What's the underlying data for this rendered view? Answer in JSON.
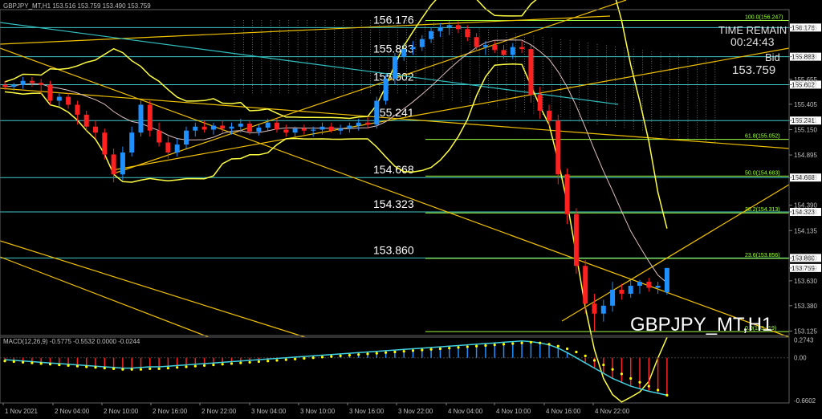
{
  "header": {
    "symbol_info": "GBPJPY_MT,H1  153.516 153.759 153.490 153.759"
  },
  "timer": {
    "label": "TIME REMAIN",
    "value": "00:24:43"
  },
  "bid": {
    "label": "Bid",
    "value": "153.759"
  },
  "watermark": "GBPJPY_MT,H1",
  "macd_header": "MACD(12,26,9) -0.5775 -0.5532 0.0000 -0.0244",
  "colors": {
    "bull": "#1e90ff",
    "bear": "#ff2020",
    "level": "#40c8c8",
    "trend": "#f0c000",
    "bands": "#ffff40",
    "fib": "#a0ff40"
  },
  "chart_data": [
    {
      "type": "candlestick",
      "title": "GBPJPY_MT,H1",
      "ylim": [
        153.08,
        156.34
      ],
      "y_ticks": [
        "156.176",
        "155.883",
        "155.655",
        "155.602",
        "155.405",
        "155.241",
        "155.150",
        "154.895",
        "154.668",
        "154.390",
        "154.323",
        "154.135",
        "153.860",
        "153.759",
        "153.630",
        "153.380",
        "153.125"
      ],
      "x_ticks": [
        "1 Nov 2021",
        "2 Nov 04:00",
        "2 Nov 10:00",
        "2 Nov 16:00",
        "2 Nov 22:00",
        "3 Nov 04:00",
        "3 Nov 10:00",
        "3 Nov 16:00",
        "3 Nov 22:00",
        "4 Nov 04:00",
        "4 Nov 10:00",
        "4 Nov 16:00",
        "4 Nov 22:00"
      ],
      "horizontal_levels": [
        "156.176",
        "155.883",
        "155.602",
        "155.241",
        "154.668",
        "154.323",
        "153.860"
      ],
      "fib_levels": [
        {
          "label": "100.0(156.247)",
          "value": 156.247
        },
        {
          "label": "61.8(155.052)",
          "value": 155.052
        },
        {
          "label": "50.0(154.683)",
          "value": 154.683
        },
        {
          "label": "38.2(154.313)",
          "value": 154.313
        },
        {
          "label": "23.6(153.856)",
          "value": 153.856
        },
        {
          "label": "0.0(153.119)",
          "value": 153.119
        }
      ],
      "current_price": "153.759",
      "candles": [
        [
          155.6,
          155.64,
          155.55,
          155.58
        ],
        [
          155.58,
          155.62,
          155.54,
          155.6
        ],
        [
          155.6,
          155.68,
          155.56,
          155.64
        ],
        [
          155.64,
          155.68,
          155.58,
          155.62
        ],
        [
          155.62,
          155.66,
          155.5,
          155.6
        ],
        [
          155.6,
          155.64,
          155.4,
          155.44
        ],
        [
          155.44,
          155.52,
          155.38,
          155.48
        ],
        [
          155.48,
          155.52,
          155.36,
          155.4
        ],
        [
          155.4,
          155.44,
          155.2,
          155.3
        ],
        [
          155.3,
          155.34,
          155.14,
          155.18
        ],
        [
          155.18,
          155.24,
          155.06,
          155.12
        ],
        [
          155.12,
          155.16,
          154.85,
          154.9
        ],
        [
          154.9,
          154.96,
          154.62,
          154.7
        ],
        [
          154.7,
          154.98,
          154.64,
          154.92
        ],
        [
          154.92,
          155.18,
          154.88,
          155.12
        ],
        [
          155.12,
          155.44,
          155.08,
          155.4
        ],
        [
          155.4,
          155.44,
          155.08,
          155.14
        ],
        [
          155.14,
          155.22,
          154.98,
          155.02
        ],
        [
          155.02,
          155.08,
          154.86,
          154.92
        ],
        [
          154.92,
          155.06,
          154.88,
          155.0
        ],
        [
          155.0,
          155.18,
          154.96,
          155.14
        ],
        [
          155.14,
          155.22,
          155.08,
          155.18
        ],
        [
          155.18,
          155.24,
          155.12,
          155.15
        ],
        [
          155.15,
          155.22,
          155.1,
          155.19
        ],
        [
          155.19,
          155.24,
          155.12,
          155.16
        ],
        [
          155.16,
          155.22,
          155.1,
          155.18
        ],
        [
          155.18,
          155.26,
          155.12,
          155.21
        ],
        [
          155.21,
          155.24,
          155.1,
          155.13
        ],
        [
          155.13,
          155.2,
          155.09,
          155.17
        ],
        [
          155.17,
          155.26,
          155.14,
          155.22
        ],
        [
          155.22,
          155.26,
          155.12,
          155.15
        ],
        [
          155.15,
          155.2,
          155.08,
          155.12
        ],
        [
          155.12,
          155.18,
          155.08,
          155.16
        ],
        [
          155.16,
          155.2,
          155.1,
          155.14
        ],
        [
          155.14,
          155.18,
          155.08,
          155.15
        ],
        [
          155.15,
          155.22,
          155.1,
          155.18
        ],
        [
          155.18,
          155.22,
          155.12,
          155.14
        ],
        [
          155.14,
          155.2,
          155.1,
          155.16
        ],
        [
          155.16,
          155.22,
          155.12,
          155.19
        ],
        [
          155.19,
          155.26,
          155.14,
          155.22
        ],
        [
          155.22,
          155.28,
          155.16,
          155.2
        ],
        [
          155.2,
          155.48,
          155.16,
          155.44
        ],
        [
          155.44,
          155.7,
          155.4,
          155.66
        ],
        [
          155.66,
          155.92,
          155.6,
          155.88
        ],
        [
          155.88,
          156.02,
          155.84,
          155.96
        ],
        [
          155.96,
          156.04,
          155.9,
          155.98
        ],
        [
          155.98,
          156.1,
          155.94,
          156.06
        ],
        [
          156.06,
          156.18,
          156.02,
          156.14
        ],
        [
          156.14,
          156.22,
          156.08,
          156.18
        ],
        [
          156.18,
          156.24,
          156.1,
          156.2
        ],
        [
          156.2,
          156.24,
          156.12,
          156.16
        ],
        [
          156.16,
          156.2,
          156.04,
          156.08
        ],
        [
          156.08,
          156.12,
          155.94,
          155.98
        ],
        [
          155.98,
          156.04,
          155.9,
          156.0
        ],
        [
          156.0,
          156.04,
          155.92,
          155.95
        ],
        [
          155.95,
          156.0,
          155.86,
          155.9
        ],
        [
          155.9,
          156.02,
          155.86,
          155.98
        ],
        [
          155.98,
          156.04,
          155.92,
          155.96
        ],
        [
          155.96,
          156.0,
          155.42,
          155.5
        ],
        [
          155.5,
          155.58,
          155.26,
          155.34
        ],
        [
          155.34,
          155.4,
          155.18,
          155.24
        ],
        [
          155.24,
          155.3,
          154.6,
          154.7
        ],
        [
          154.7,
          154.76,
          154.2,
          154.3
        ],
        [
          154.3,
          154.36,
          153.7,
          153.78
        ],
        [
          153.78,
          153.84,
          153.3,
          153.4
        ],
        [
          153.4,
          153.5,
          153.12,
          153.3
        ],
        [
          153.3,
          153.44,
          153.22,
          153.38
        ],
        [
          153.38,
          153.62,
          153.32,
          153.54
        ],
        [
          153.54,
          153.6,
          153.44,
          153.5
        ],
        [
          153.5,
          153.64,
          153.46,
          153.58
        ],
        [
          153.58,
          153.64,
          153.5,
          153.62
        ],
        [
          153.62,
          153.66,
          153.52,
          153.56
        ],
        [
          153.56,
          153.62,
          153.5,
          153.58
        ],
        [
          153.516,
          153.759,
          153.49,
          153.759
        ]
      ]
    },
    {
      "type": "bar",
      "title": "MACD(12,26,9)",
      "ylim": [
        -0.7,
        0.32
      ],
      "y_ticks": [
        "0.2743",
        "0.00",
        "-0.6602"
      ],
      "macd_hist": [
        -0.03,
        -0.04,
        -0.05,
        -0.06,
        -0.07,
        -0.08,
        -0.09,
        -0.1,
        -0.11,
        -0.12,
        -0.13,
        -0.14,
        -0.15,
        -0.16,
        -0.16,
        -0.15,
        -0.14,
        -0.14,
        -0.13,
        -0.12,
        -0.11,
        -0.1,
        -0.09,
        -0.08,
        -0.07,
        -0.06,
        -0.05,
        -0.04,
        -0.03,
        -0.02,
        -0.01,
        0.0,
        0.01,
        0.02,
        0.03,
        0.04,
        0.05,
        0.06,
        0.07,
        0.08,
        0.09,
        0.1,
        0.11,
        0.12,
        0.13,
        0.14,
        0.15,
        0.16,
        0.17,
        0.18,
        0.19,
        0.2,
        0.21,
        0.22,
        0.23,
        0.24,
        0.25,
        0.26,
        0.25,
        0.23,
        0.2,
        0.15,
        0.08,
        0.0,
        -0.08,
        -0.16,
        -0.24,
        -0.32,
        -0.38,
        -0.44,
        -0.48,
        -0.52,
        -0.55,
        -0.58
      ],
      "signal": [
        -0.05,
        -0.06,
        -0.07,
        -0.08,
        -0.09,
        -0.1,
        -0.11,
        -0.12,
        -0.13,
        -0.14,
        -0.15,
        -0.16,
        -0.17,
        -0.18,
        -0.18,
        -0.18,
        -0.17,
        -0.17,
        -0.16,
        -0.15,
        -0.14,
        -0.13,
        -0.12,
        -0.11,
        -0.1,
        -0.09,
        -0.08,
        -0.07,
        -0.06,
        -0.05,
        -0.04,
        -0.03,
        -0.02,
        -0.01,
        0.0,
        0.01,
        0.02,
        0.03,
        0.04,
        0.05,
        0.06,
        0.07,
        0.08,
        0.09,
        0.1,
        0.11,
        0.12,
        0.13,
        0.14,
        0.15,
        0.16,
        0.17,
        0.18,
        0.19,
        0.2,
        0.21,
        0.22,
        0.23,
        0.24,
        0.23,
        0.21,
        0.18,
        0.14,
        0.09,
        0.03,
        -0.04,
        -0.11,
        -0.18,
        -0.25,
        -0.32,
        -0.38,
        -0.44,
        -0.5,
        -0.58
      ]
    }
  ]
}
